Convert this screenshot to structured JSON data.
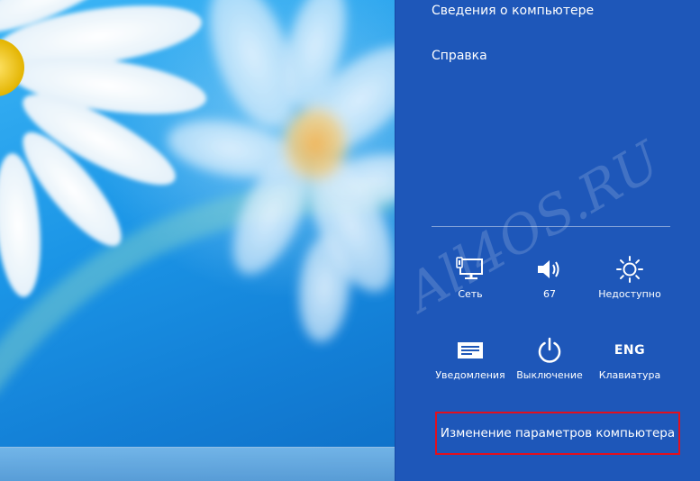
{
  "settings_panel": {
    "links": {
      "about_pc": "Сведения о компьютере",
      "help": "Справка"
    },
    "tiles": {
      "network": {
        "label": "Сеть",
        "icon": "network-monitor-icon"
      },
      "volume": {
        "label": "67",
        "icon": "speaker-icon"
      },
      "brightness": {
        "label": "Недоступно",
        "icon": "brightness-sun-icon"
      },
      "notifications": {
        "label": "Уведомления",
        "icon": "notifications-icon"
      },
      "power": {
        "label": "Выключение",
        "icon": "power-icon"
      },
      "keyboard": {
        "label": "Клавиатура",
        "icon_text": "ENG"
      }
    },
    "change_pc_settings": "Изменение параметров компьютера",
    "highlight_color": "#e2101e",
    "panel_color": "#1e57b9"
  },
  "watermark": "All4OS.RU"
}
